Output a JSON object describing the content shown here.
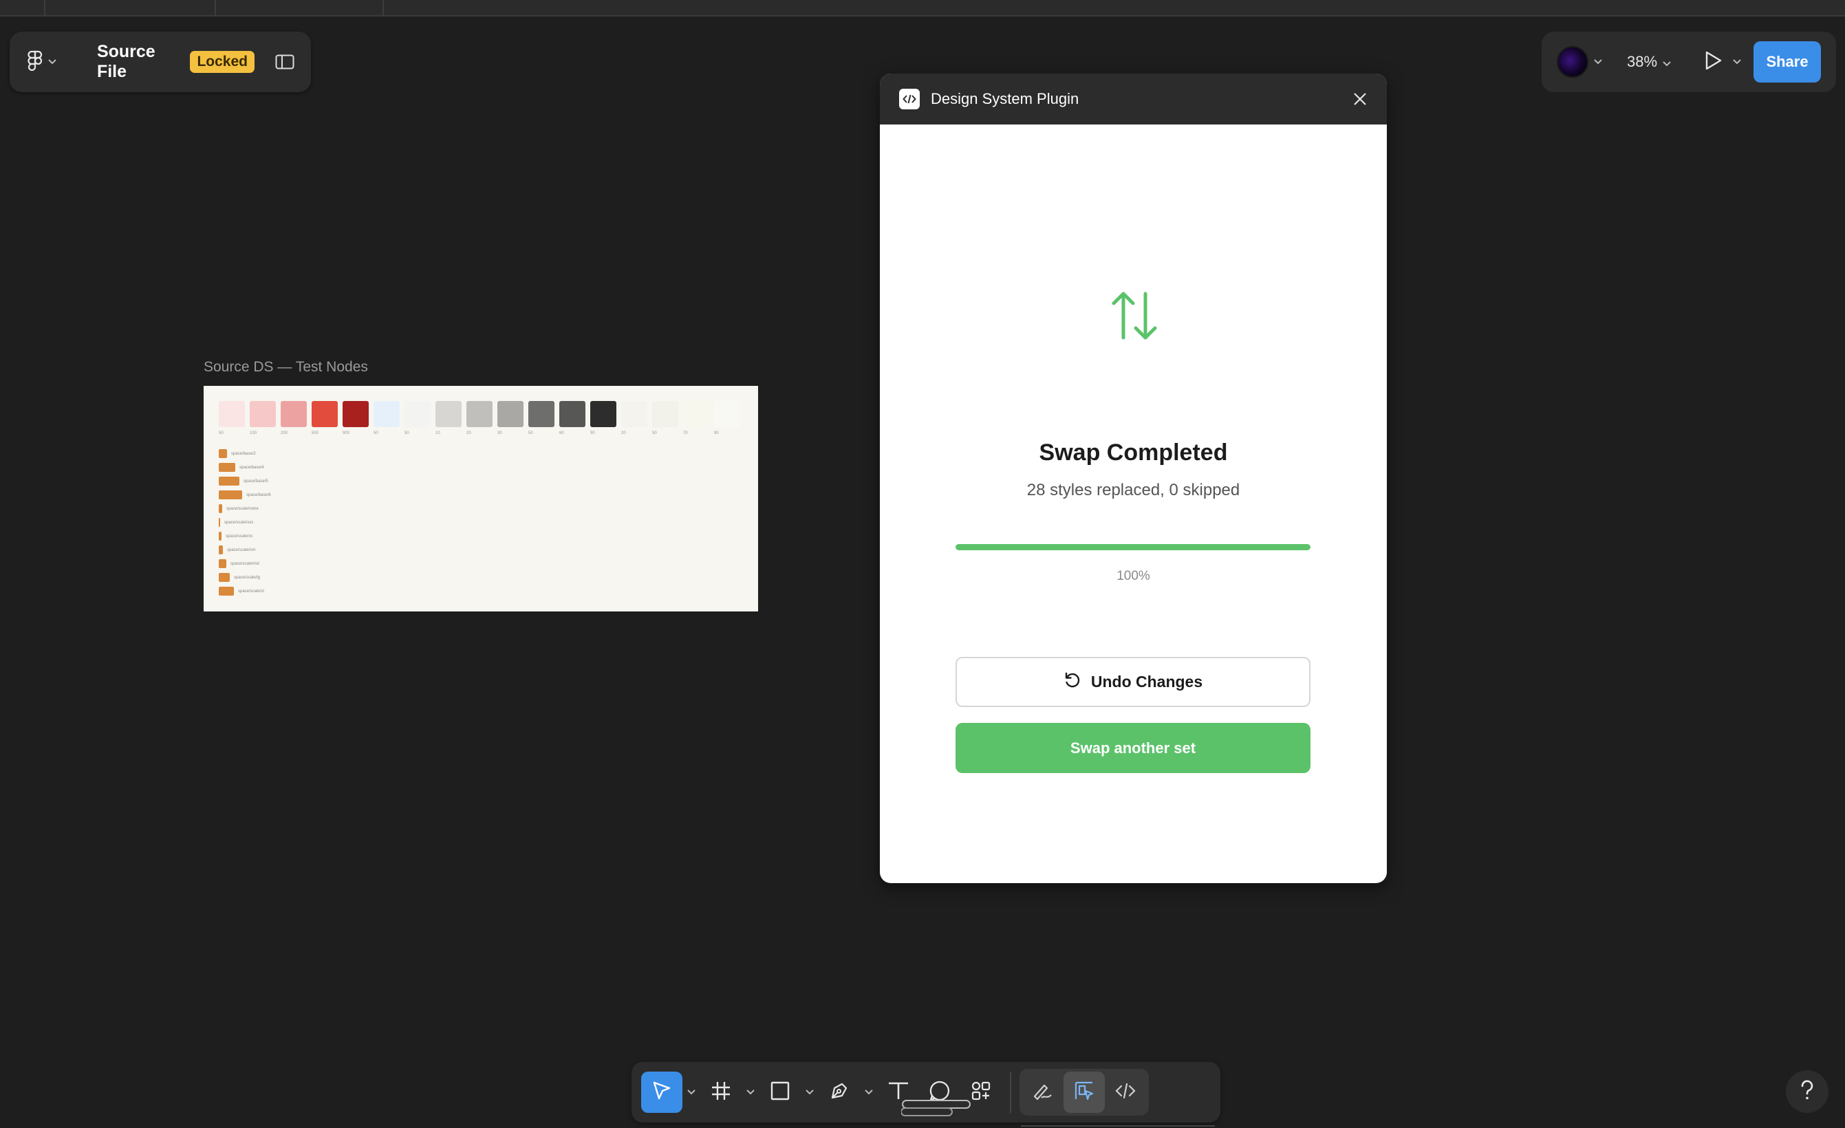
{
  "file": {
    "title": "Source File",
    "badge": "Locked"
  },
  "top_right": {
    "zoom": "38%",
    "share_label": "Share"
  },
  "canvas": {
    "frame_label": "Source DS — Test Nodes",
    "swatches": [
      {
        "color": "#fbe4e4",
        "tick": "50"
      },
      {
        "color": "#f7c8c8",
        "tick": "100"
      },
      {
        "color": "#eda2a2",
        "tick": "200"
      },
      {
        "color": "#e24c3c",
        "tick": "500"
      },
      {
        "color": "#a8211f",
        "tick": "900"
      },
      {
        "color": "#e6f0fb",
        "tick": "50"
      },
      {
        "color": "#f3f3f1",
        "tick": "50"
      },
      {
        "color": "#d7d6d2",
        "tick": "10"
      },
      {
        "color": "#c0bfbb",
        "tick": "20"
      },
      {
        "color": "#a9a8a4",
        "tick": "30"
      },
      {
        "color": "#6e6e6c",
        "tick": "50"
      },
      {
        "color": "#575756",
        "tick": "60"
      },
      {
        "color": "#2d2d2d",
        "tick": "90"
      },
      {
        "color": "#f4f3ee",
        "tick": "20"
      },
      {
        "color": "#f2f2ea",
        "tick": "50"
      },
      {
        "color": "#f8f7ee",
        "tick": "70"
      },
      {
        "color": "#f9f9f4",
        "tick": "90"
      }
    ],
    "spacing": [
      {
        "label": "space/base/2",
        "size": 12
      },
      {
        "label": "space/base/4",
        "size": 24
      },
      {
        "label": "space/base/5",
        "size": 30
      },
      {
        "label": "space/base/6",
        "size": 34
      },
      {
        "label": "space/scale/none",
        "size": 5
      },
      {
        "label": "space/scale/xxs",
        "size": 2
      },
      {
        "label": "space/scale/xs",
        "size": 4
      },
      {
        "label": "space/scale/sm",
        "size": 6
      },
      {
        "label": "space/scale/md",
        "size": 11
      },
      {
        "label": "space/scale/lg",
        "size": 16
      },
      {
        "label": "space/scale/xl",
        "size": 22
      }
    ]
  },
  "plugin": {
    "title": "Design System Plugin",
    "status_title": "Swap Completed",
    "status_sub": "28 styles replaced, 0 skipped",
    "progress_value": 1.0,
    "progress_label": "100%",
    "undo_label": "Undo Changes",
    "swap_again_label": "Swap another set",
    "accent": "#5cc26a"
  },
  "colors": {
    "brand_blue": "#3b8ee8",
    "locked_badge": "#f3c03f"
  }
}
